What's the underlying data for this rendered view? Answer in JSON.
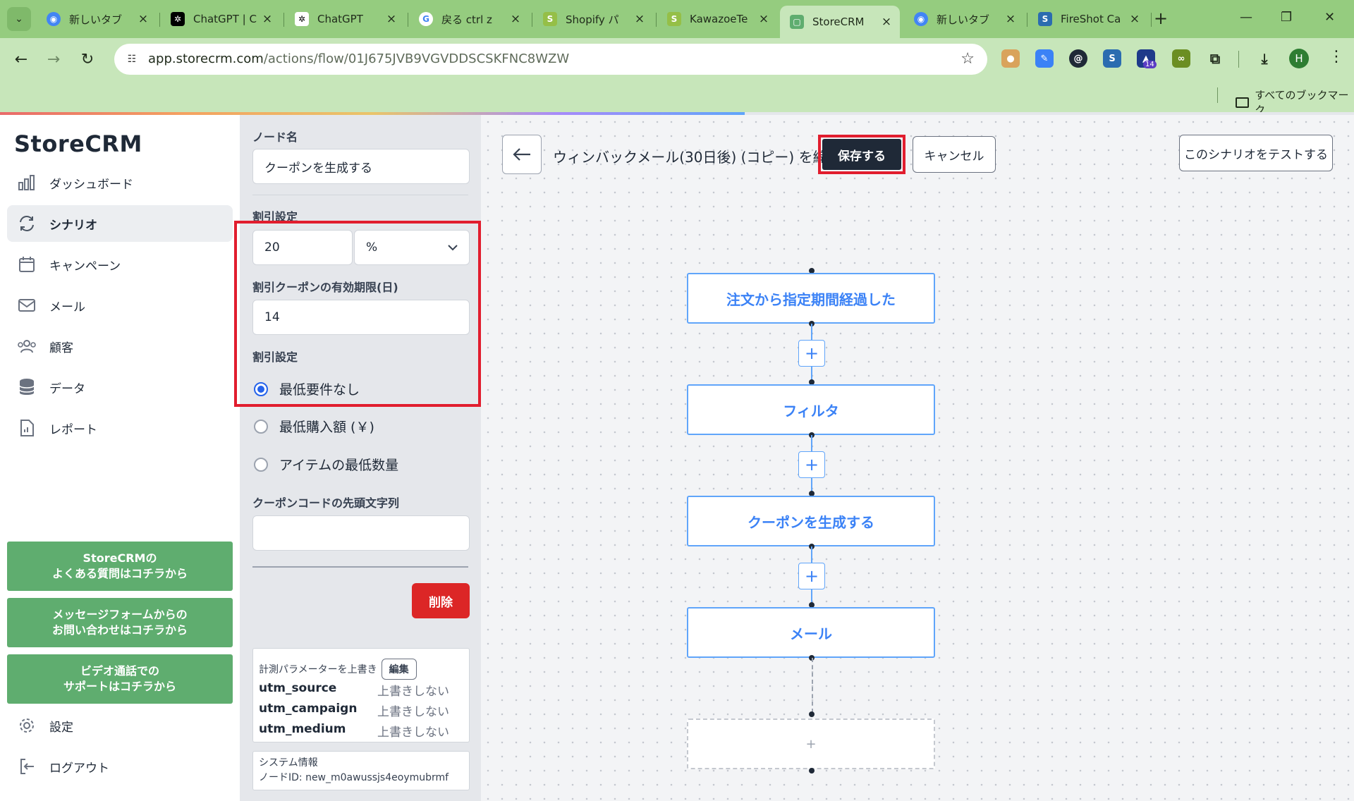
{
  "browser": {
    "tabs": [
      {
        "title": "新しいタブ",
        "icon": "chrome-icon",
        "color": "#4285f4"
      },
      {
        "title": "ChatGPT | C",
        "icon": "openai-icon",
        "color": "#000000"
      },
      {
        "title": "ChatGPT",
        "icon": "openai-icon",
        "color": "#ffffff"
      },
      {
        "title": "戻る ctrl z",
        "icon": "google-icon",
        "color": "#ffffff"
      },
      {
        "title": "Shopify パ",
        "icon": "shopify-icon",
        "color": "#95bf47"
      },
      {
        "title": "KawazoeTe",
        "icon": "shopify-icon",
        "color": "#95bf47"
      },
      {
        "title": "StoreCRM",
        "icon": "storecrm-icon",
        "color": "#5fad6f",
        "active": true
      },
      {
        "title": "新しいタブ",
        "icon": "chrome-icon",
        "color": "#4285f4"
      },
      {
        "title": "FireShot Ca",
        "icon": "fireshot-icon",
        "color": "#2b6cb0"
      }
    ],
    "url_host": "app.storecrm.com",
    "url_path": "/actions/flow/01J675JVB9VGVDDSCSKFNC8WZW",
    "extension_badge": "14",
    "profile_initial": "H",
    "bookmarks_all": "すべてのブックマーク",
    "load_progress": 0.55
  },
  "sidebar": {
    "brand": "StoreCRM",
    "items": [
      {
        "label": "ダッシュボード",
        "icon": "bar-chart-icon"
      },
      {
        "label": "シナリオ",
        "icon": "refresh-icon",
        "active": true
      },
      {
        "label": "キャンペーン",
        "icon": "calendar-icon"
      },
      {
        "label": "メール",
        "icon": "mail-icon"
      },
      {
        "label": "顧客",
        "icon": "users-icon"
      },
      {
        "label": "データ",
        "icon": "database-icon"
      },
      {
        "label": "レポート",
        "icon": "report-icon"
      }
    ],
    "help_buttons": [
      {
        "line1": "StoreCRMの",
        "line2": "よくある質問はコチラから"
      },
      {
        "line1": "メッセージフォームからの",
        "line2": "お問い合わせはコチラから"
      },
      {
        "line1": "ビデオ通話での",
        "line2": "サポートはコチラから"
      }
    ],
    "settings": "設定",
    "logout": "ログアウト"
  },
  "node_panel": {
    "node_name_label": "ノード名",
    "node_name_value": "クーポンを生成する",
    "discount_label": "割引設定",
    "discount_value": "20",
    "discount_unit": "%",
    "expiry_label": "割引クーポンの有効期限(日)",
    "expiry_value": "14",
    "condition_label": "割引設定",
    "radios": [
      {
        "label": "最低要件なし",
        "checked": true
      },
      {
        "label": "最低購入額 (￥)",
        "checked": false
      },
      {
        "label": "アイテムの最低数量",
        "checked": false
      }
    ],
    "prefix_label": "クーポンコードの先頭文字列",
    "prefix_value": "",
    "delete": "削除",
    "utm_header": "計測パラメーターを上書き",
    "utm_edit": "編集",
    "utm_rows": [
      {
        "key": "utm_source",
        "value": "上書きしない"
      },
      {
        "key": "utm_campaign",
        "value": "上書きしない"
      },
      {
        "key": "utm_medium",
        "value": "上書きしない"
      }
    ],
    "system_info_title": "システム情報",
    "system_info_node_id": "ノードID: new_m0awussjs4eoymubrmf"
  },
  "canvas": {
    "title": "ウィンバックメール(30日後) (コピー) を編集中",
    "save": "保存する",
    "cancel": "キャンセル",
    "test": "このシナリオをテストする",
    "nodes": [
      "注文から指定期間経過した",
      "フィルタ",
      "クーポンを生成する",
      "メール"
    ],
    "add_symbol": "+"
  },
  "colors": {
    "highlight": "#e11d2e",
    "accent_blue": "#3b82f6",
    "help_green": "#5fad6f",
    "delete_red": "#dc2626",
    "chrome_green": "#95cc7f"
  }
}
